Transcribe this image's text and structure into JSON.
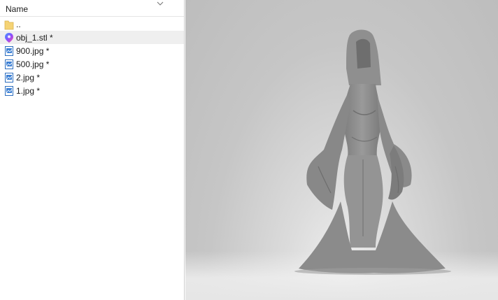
{
  "explorer": {
    "column_header": "Name",
    "items": [
      {
        "label": "..",
        "icon": "folder-icon"
      },
      {
        "label": "obj_1.stl *",
        "icon": "3d-model-icon",
        "selected": true
      },
      {
        "label": "900.jpg *",
        "icon": "image-file-icon"
      },
      {
        "label": "500.jpg *",
        "icon": "image-file-icon"
      },
      {
        "label": "2.jpg *",
        "icon": "image-file-icon"
      },
      {
        "label": "1.jpg *",
        "icon": "image-file-icon"
      }
    ]
  },
  "viewport": {
    "subject": "3d-figure-model",
    "background_color": "#c4c4c4",
    "model_color": "#8e8e8e"
  }
}
